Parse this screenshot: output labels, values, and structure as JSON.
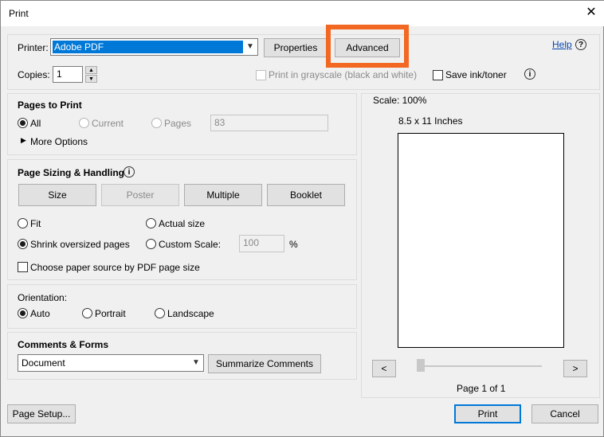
{
  "window": {
    "title": "Print",
    "close_glyph": "✕"
  },
  "printer": {
    "label": "Printer:",
    "value": "Adobe PDF",
    "properties_button": "Properties",
    "advanced_button": "Advanced",
    "help_link": "Help",
    "help_icon": "help-circle-icon"
  },
  "copies": {
    "label": "Copies:",
    "value": "1",
    "grayscale_label": "Print in grayscale (black and white)",
    "grayscale_checked": false,
    "save_ink_label": "Save ink/toner",
    "save_ink_checked": false
  },
  "pages_to_print": {
    "heading": "Pages to Print",
    "all_label": "All",
    "current_label": "Current",
    "pages_label": "Pages",
    "pages_value": "83",
    "selected": "All",
    "more_options_label": "More Options"
  },
  "page_sizing": {
    "heading": "Page Sizing & Handling",
    "tabs": [
      "Size",
      "Poster",
      "Multiple",
      "Booklet"
    ],
    "fit_label": "Fit",
    "actual_size_label": "Actual size",
    "shrink_label": "Shrink oversized pages",
    "custom_scale_label": "Custom Scale:",
    "custom_scale_value": "100",
    "percent": "%",
    "selected": "Shrink oversized pages",
    "paper_source_label": "Choose paper source by PDF page size",
    "paper_source_checked": false
  },
  "orientation": {
    "heading": "Orientation:",
    "auto_label": "Auto",
    "portrait_label": "Portrait",
    "landscape_label": "Landscape",
    "selected": "Auto"
  },
  "comments_forms": {
    "heading": "Comments & Forms",
    "value": "Document",
    "summarize_button": "Summarize Comments"
  },
  "preview": {
    "scale": "Scale: 100%",
    "paper_size": "8.5 x 11 Inches",
    "prev_glyph": "<",
    "next_glyph": ">",
    "page_indicator": "Page 1 of 1"
  },
  "footer": {
    "page_setup_button": "Page Setup...",
    "print_button": "Print",
    "cancel_button": "Cancel"
  },
  "colors": {
    "highlight_box": "#f26722",
    "selection": "#0078d7"
  }
}
